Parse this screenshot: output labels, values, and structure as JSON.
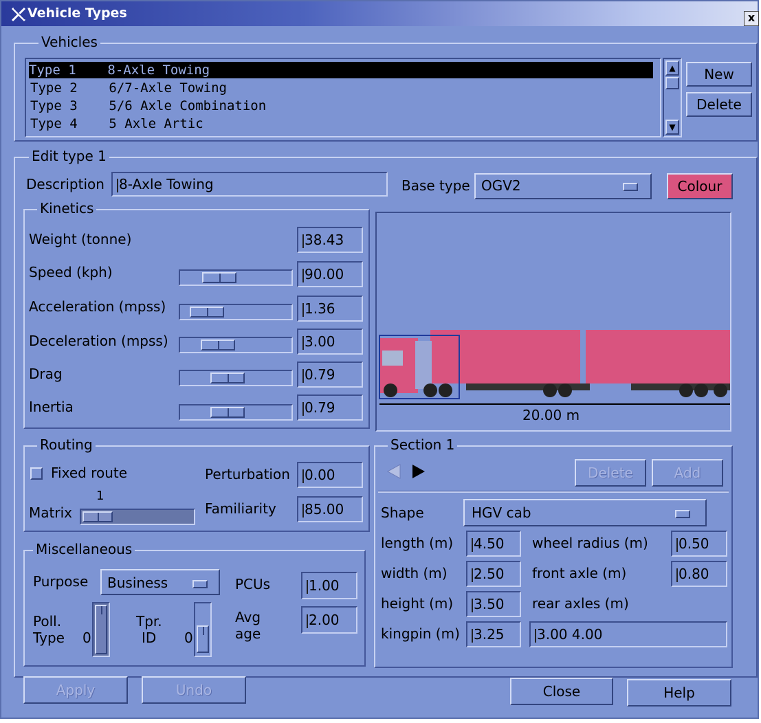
{
  "window": {
    "title": "Vehicle Types",
    "close_label": "x"
  },
  "vehicles": {
    "group_title": "Vehicles",
    "items": [
      {
        "type": "Type 1",
        "name": "8-Axle Towing"
      },
      {
        "type": "Type 2",
        "name": "6/7-Axle Towing"
      },
      {
        "type": "Type 3",
        "name": "5/6 Axle Combination"
      },
      {
        "type": "Type 4",
        "name": "5 Axle Artic"
      }
    ],
    "new_label": "New",
    "delete_label": "Delete"
  },
  "edit": {
    "group_title": "Edit type 1",
    "description_label": "Description",
    "description_value": "8-Axle Towing",
    "base_type_label": "Base type",
    "base_type_value": "OGV2",
    "colour_label": "Colour",
    "colour_hex": "#d9547f"
  },
  "kinetics": {
    "group_title": "Kinetics",
    "rows": [
      {
        "label": "Weight (tonne)",
        "value": "38.43"
      },
      {
        "label": "Speed (kph)",
        "value": "90.00"
      },
      {
        "label": "Acceleration (mpss)",
        "value": "1.36"
      },
      {
        "label": "Deceleration (mpss)",
        "value": "3.00"
      },
      {
        "label": "Drag",
        "value": "0.79"
      },
      {
        "label": "Inertia",
        "value": "0.79"
      }
    ]
  },
  "preview": {
    "length_label": "20.00 m",
    "vehicle_color": "#d9547f"
  },
  "routing": {
    "group_title": "Routing",
    "fixed_route_label": "Fixed route",
    "perturbation_label": "Perturbation",
    "perturbation_value": "0.00",
    "matrix_label": "Matrix",
    "matrix_value": "1",
    "familiarity_label": "Familiarity",
    "familiarity_value": "85.00"
  },
  "misc": {
    "group_title": "Miscellaneous",
    "purpose_label": "Purpose",
    "purpose_value": "Business",
    "pcus_label": "PCUs",
    "pcus_value": "1.00",
    "poll_label_1": "Poll.",
    "poll_label_2": "Type",
    "poll_value": "0",
    "tpr_label_1": "Tpr.",
    "tpr_label_2": "ID",
    "tpr_value": "0",
    "avg_label_1": "Avg",
    "avg_label_2": "age",
    "avg_value": "2.00"
  },
  "section": {
    "group_title": "Section 1",
    "delete_label": "Delete",
    "add_label": "Add",
    "shape_label": "Shape",
    "shape_value": "HGV cab",
    "length_label": "length (m)",
    "length_value": "4.50",
    "width_label": "width (m)",
    "width_value": "2.50",
    "height_label": "height (m)",
    "height_value": "3.50",
    "kingpin_label": "kingpin (m)",
    "kingpin_value": "3.25",
    "wheel_radius_label": "wheel radius (m)",
    "wheel_radius_value": "0.50",
    "front_axle_label": "front axle (m)",
    "front_axle_value": "0.80",
    "rear_axles_label": "rear axles (m)",
    "rear_axles_value": "3.00 4.00"
  },
  "footer": {
    "apply_label": "Apply",
    "undo_label": "Undo",
    "close_label": "Close",
    "help_label": "Help"
  }
}
